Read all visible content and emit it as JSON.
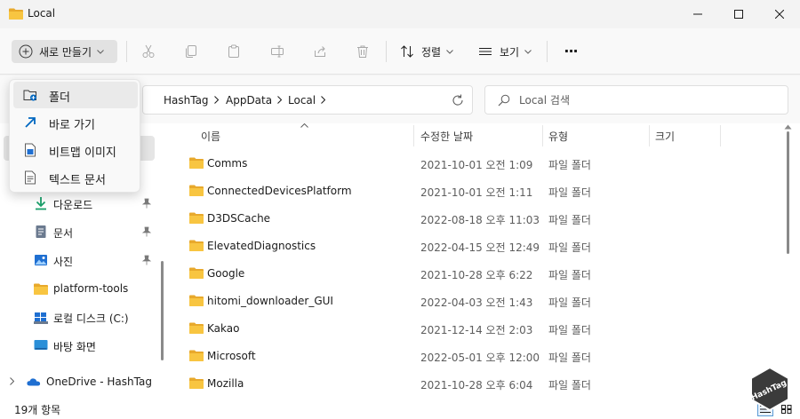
{
  "window": {
    "title": "Local"
  },
  "toolbar": {
    "new_label": "새로 만들기",
    "sort_label": "정렬",
    "view_label": "보기",
    "more_label": "···"
  },
  "address": {
    "breadcrumb": [
      "HashTag",
      "AppData",
      "Local"
    ]
  },
  "search": {
    "placeholder": "Local 검색"
  },
  "new_menu": {
    "items": [
      {
        "label": "폴더",
        "icon": "new-folder-icon"
      },
      {
        "label": "바로 가기",
        "icon": "shortcut-arrow-icon"
      },
      {
        "label": "비트맵 이미지",
        "icon": "bitmap-image-icon"
      },
      {
        "label": "텍스트 문서",
        "icon": "text-document-icon"
      }
    ]
  },
  "nav": {
    "items": [
      {
        "label": "다운로드",
        "icon": "download-icon",
        "pinned": true
      },
      {
        "label": "문서",
        "icon": "documents-icon",
        "pinned": true
      },
      {
        "label": "사진",
        "icon": "pictures-icon",
        "pinned": true
      },
      {
        "label": "platform-tools",
        "icon": "folder-icon",
        "pinned": false
      },
      {
        "label": "로컬 디스크 (C:)",
        "icon": "drive-icon",
        "pinned": false
      },
      {
        "label": "바탕 화면",
        "icon": "desktop-icon",
        "pinned": false
      },
      {
        "label": "OneDrive - HashTag",
        "icon": "onedrive-cloud-icon",
        "pinned": false
      }
    ]
  },
  "columns": {
    "name": "이름",
    "date": "수정한 날짜",
    "type": "유형",
    "size": "크기"
  },
  "files": [
    {
      "name": "Comms",
      "date": "2021-10-01 오전 1:09",
      "type": "파일 폴더"
    },
    {
      "name": "ConnectedDevicesPlatform",
      "date": "2021-10-01 오전 1:11",
      "type": "파일 폴더"
    },
    {
      "name": "D3DSCache",
      "date": "2022-08-18 오후 11:03",
      "type": "파일 폴더"
    },
    {
      "name": "ElevatedDiagnostics",
      "date": "2022-04-15 오전 12:49",
      "type": "파일 폴더"
    },
    {
      "name": "Google",
      "date": "2021-10-28 오후 6:22",
      "type": "파일 폴더"
    },
    {
      "name": "hitomi_downloader_GUI",
      "date": "2022-04-03 오전 1:43",
      "type": "파일 폴더"
    },
    {
      "name": "Kakao",
      "date": "2021-12-14 오전 2:03",
      "type": "파일 폴더"
    },
    {
      "name": "Microsoft",
      "date": "2022-05-01 오후 12:00",
      "type": "파일 폴더"
    },
    {
      "name": "Mozilla",
      "date": "2021-10-28 오후 6:04",
      "type": "파일 폴더"
    }
  ],
  "status": {
    "item_count": "19개 항목"
  },
  "watermark": {
    "text": "HashTag"
  },
  "colors": {
    "folder_yellow": "#f8c541",
    "accent_blue": "#0067c0"
  }
}
